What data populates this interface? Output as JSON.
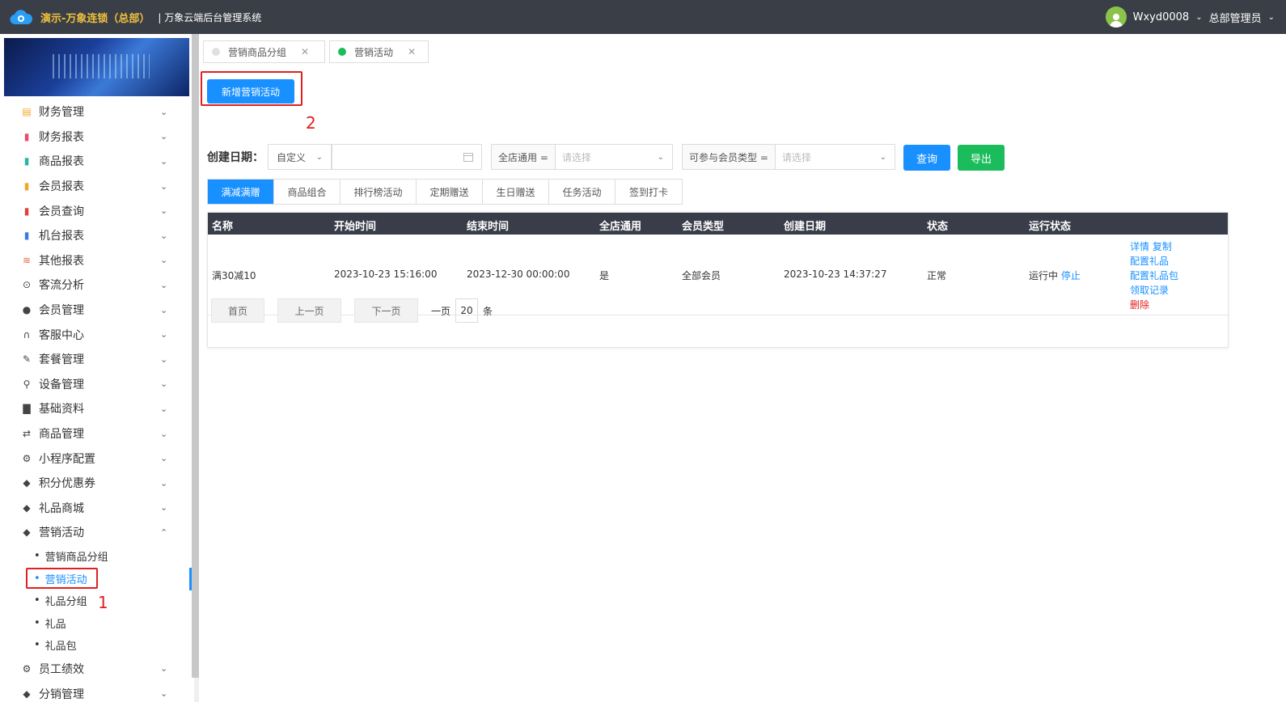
{
  "header": {
    "brand": "演示-万象连锁（总部）",
    "system_name": "| 万象云端后台管理系统",
    "user_name": "Wxyd0008",
    "role": "总部管理员"
  },
  "sidebar": {
    "menu_top": [
      {
        "label": "财务管理",
        "icon": "wallet-icon",
        "color": "#f5a623"
      },
      {
        "label": "财务报表",
        "icon": "finance-report-icon",
        "color": "#e94b6a"
      },
      {
        "label": "商品报表",
        "icon": "product-report-icon",
        "color": "#2bb3a5"
      },
      {
        "label": "会员报表",
        "icon": "member-report-icon",
        "color": "#f5a623"
      },
      {
        "label": "会员查询",
        "icon": "member-query-icon",
        "color": "#e04040"
      },
      {
        "label": "机台报表",
        "icon": "machine-report-icon",
        "color": "#3a7be0"
      },
      {
        "label": "其他报表",
        "icon": "layers-icon",
        "color": "#e8663a"
      },
      {
        "label": "客流分析",
        "icon": "target-icon",
        "color": "#444"
      },
      {
        "label": "会员管理",
        "icon": "user-icon",
        "color": "#444"
      },
      {
        "label": "客服中心",
        "icon": "headset-icon",
        "color": "#444"
      },
      {
        "label": "套餐管理",
        "icon": "edit-icon",
        "color": "#444"
      },
      {
        "label": "设备管理",
        "icon": "device-icon",
        "color": "#444"
      },
      {
        "label": "基础资料",
        "icon": "file-icon",
        "color": "#444"
      },
      {
        "label": "商品管理",
        "icon": "swap-icon",
        "color": "#444"
      },
      {
        "label": "小程序配置",
        "icon": "gear-icon",
        "color": "#444"
      },
      {
        "label": "积分优惠券",
        "icon": "tag-icon",
        "color": "#444"
      },
      {
        "label": "礼品商城",
        "icon": "tag-icon",
        "color": "#444"
      },
      {
        "label": "营销活动",
        "icon": "tag-icon",
        "color": "#444"
      }
    ],
    "sub_items": [
      "营销商品分组",
      "营销活动",
      "礼品分组",
      "礼品",
      "礼品包"
    ],
    "menu_bottom": [
      {
        "label": "员工绩效",
        "icon": "gear-icon",
        "color": "#444"
      },
      {
        "label": "分销管理",
        "icon": "tag-icon",
        "color": "#444"
      }
    ],
    "annotation_1": "1"
  },
  "page_tabs": [
    {
      "label": "营销商品分组",
      "dot_color": "#e0e0e0"
    },
    {
      "label": "营销活动",
      "dot_color": "#1bbc5c"
    }
  ],
  "toolbar": {
    "add_label": "新增营销活动",
    "annotation_2": "2"
  },
  "filters": {
    "date_label": "创建日期：",
    "date_mode": "自定义",
    "store_prefix": "全店通用 =",
    "store_placeholder": "请选择",
    "member_prefix": "可参与会员类型 =",
    "member_placeholder": "请选择",
    "query_label": "查询",
    "export_label": "导出"
  },
  "type_tabs": [
    "满减满赠",
    "商品组合",
    "排行榜活动",
    "定期赠送",
    "生日赠送",
    "任务活动",
    "签到打卡"
  ],
  "table": {
    "columns": [
      "名称",
      "开始时间",
      "结束时间",
      "全店通用",
      "会员类型",
      "创建日期",
      "状态",
      "运行状态"
    ],
    "row": {
      "name": "满30减10",
      "start": "2023-10-23 15:16:00",
      "end": "2023-12-30 00:00:00",
      "all_store": "是",
      "member_type": "全部会员",
      "created": "2023-10-23 14:37:27",
      "status": "正常",
      "run_status": "运行中",
      "stop": "停止",
      "ops": {
        "detail": "详情",
        "copy": "复制",
        "config_gift": "配置礼品",
        "config_gift_pack": "配置礼品包",
        "claim_record": "领取记录",
        "delete": "删除"
      }
    }
  },
  "pager": {
    "first": "首页",
    "prev": "上一页",
    "next": "下一页",
    "per_page_prefix": "一页",
    "per_page": "20",
    "per_page_suffix": "条"
  }
}
